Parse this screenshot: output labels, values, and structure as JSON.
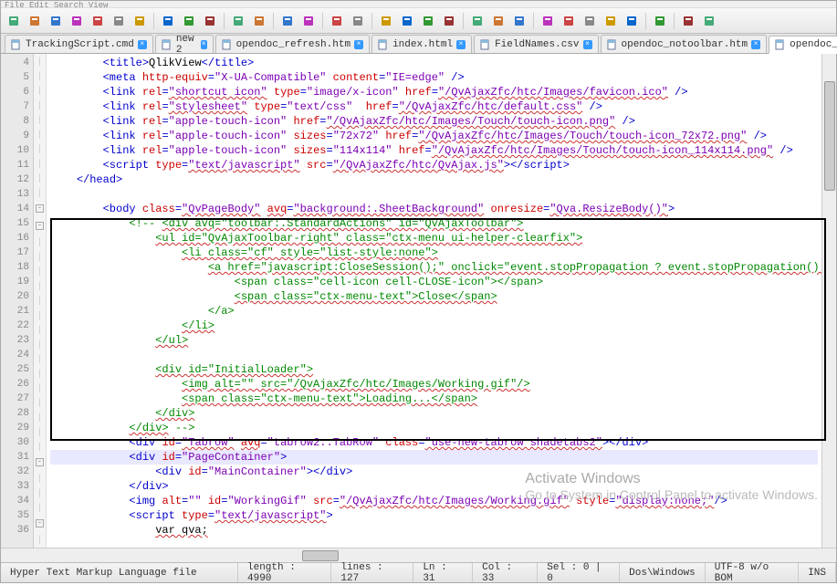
{
  "menu_hint": "File  Edit  Search  View",
  "tabs": [
    {
      "label": "TrackingScript.cmd",
      "active": false
    },
    {
      "label": "new  2",
      "active": false
    },
    {
      "label": "opendoc_refresh.htm",
      "active": false
    },
    {
      "label": "index.html",
      "active": false
    },
    {
      "label": "FieldNames.csv",
      "active": false
    },
    {
      "label": "opendoc_notoolbar.htm",
      "active": false
    },
    {
      "label": "opendoc_notoolbar.htm",
      "active": true
    }
  ],
  "line_start": 4,
  "line_end": 36,
  "cursor_line": 31,
  "code_lines": [
    {
      "n": 4,
      "indent": 2,
      "tokens": [
        [
          "t-tag",
          "<title>"
        ],
        [
          "t-txt",
          "QlikView"
        ],
        [
          "t-tag",
          "</title>"
        ]
      ]
    },
    {
      "n": 5,
      "indent": 2,
      "tokens": [
        [
          "t-tag",
          "<meta "
        ],
        [
          "t-attr",
          "http-equiv"
        ],
        [
          "t-tag",
          "="
        ],
        [
          "t-val",
          "\"X-UA-Compatible\""
        ],
        [
          "t-tag",
          " "
        ],
        [
          "t-attr",
          "content"
        ],
        [
          "t-tag",
          "="
        ],
        [
          "t-val",
          "\"IE=edge\""
        ],
        [
          "t-tag",
          " />"
        ]
      ]
    },
    {
      "n": 6,
      "indent": 2,
      "tokens": [
        [
          "t-tag",
          "<link "
        ],
        [
          "t-attr",
          "rel"
        ],
        [
          "t-tag",
          "="
        ],
        [
          "t-val t-wavy",
          "\"shortcut icon\""
        ],
        [
          "t-tag",
          " "
        ],
        [
          "t-attr",
          "type"
        ],
        [
          "t-tag",
          "="
        ],
        [
          "t-val",
          "\"image/x-icon\""
        ],
        [
          "t-tag",
          " "
        ],
        [
          "t-attr",
          "href"
        ],
        [
          "t-tag",
          "="
        ],
        [
          "t-val t-wavy",
          "\"/QvAjaxZfc/htc/Images/favicon.ico\""
        ],
        [
          "t-tag",
          " />"
        ]
      ]
    },
    {
      "n": 7,
      "indent": 2,
      "tokens": [
        [
          "t-tag",
          "<link "
        ],
        [
          "t-attr",
          "rel"
        ],
        [
          "t-tag",
          "="
        ],
        [
          "t-val t-wavy",
          "\"stylesheet\""
        ],
        [
          "t-tag",
          " "
        ],
        [
          "t-attr",
          "type"
        ],
        [
          "t-tag",
          "="
        ],
        [
          "t-val",
          "\"text/css\""
        ],
        [
          "t-tag",
          "  "
        ],
        [
          "t-attr",
          "href"
        ],
        [
          "t-tag",
          "="
        ],
        [
          "t-val t-wavy",
          "\"/QvAjaxZfc/htc/default.css\""
        ],
        [
          "t-tag",
          " />"
        ]
      ]
    },
    {
      "n": 8,
      "indent": 2,
      "tokens": [
        [
          "t-tag",
          "<link "
        ],
        [
          "t-attr",
          "rel"
        ],
        [
          "t-tag",
          "="
        ],
        [
          "t-val",
          "\"apple-touch-icon\""
        ],
        [
          "t-tag",
          " "
        ],
        [
          "t-attr",
          "href"
        ],
        [
          "t-tag",
          "="
        ],
        [
          "t-val t-wavy",
          "\"/QvAjaxZfc/htc/Images/Touch/touch-icon.png\""
        ],
        [
          "t-tag",
          " />"
        ]
      ]
    },
    {
      "n": 9,
      "indent": 2,
      "tokens": [
        [
          "t-tag",
          "<link "
        ],
        [
          "t-attr",
          "rel"
        ],
        [
          "t-tag",
          "="
        ],
        [
          "t-val",
          "\"apple-touch-icon\""
        ],
        [
          "t-tag",
          " "
        ],
        [
          "t-attr",
          "sizes"
        ],
        [
          "t-tag",
          "="
        ],
        [
          "t-val",
          "\"72x72\""
        ],
        [
          "t-tag",
          " "
        ],
        [
          "t-attr",
          "href"
        ],
        [
          "t-tag",
          "="
        ],
        [
          "t-val t-wavy",
          "\"/QvAjaxZfc/htc/Images/Touch/touch-icon_72x72.png\""
        ],
        [
          "t-tag",
          " />"
        ]
      ]
    },
    {
      "n": 10,
      "indent": 2,
      "tokens": [
        [
          "t-tag",
          "<link "
        ],
        [
          "t-attr",
          "rel"
        ],
        [
          "t-tag",
          "="
        ],
        [
          "t-val",
          "\"apple-touch-icon\""
        ],
        [
          "t-tag",
          " "
        ],
        [
          "t-attr",
          "sizes"
        ],
        [
          "t-tag",
          "="
        ],
        [
          "t-val",
          "\"114x114\""
        ],
        [
          "t-tag",
          " "
        ],
        [
          "t-attr",
          "href"
        ],
        [
          "t-tag",
          "="
        ],
        [
          "t-val t-wavy",
          "\"/QvAjaxZfc/htc/Images/Touch/touch-icon_114x114.png\""
        ],
        [
          "t-tag",
          " />"
        ]
      ]
    },
    {
      "n": 11,
      "indent": 2,
      "tokens": [
        [
          "t-tag",
          "<script "
        ],
        [
          "t-attr",
          "type"
        ],
        [
          "t-tag",
          "="
        ],
        [
          "t-val t-wavy",
          "\"text/javascript\""
        ],
        [
          "t-tag",
          " "
        ],
        [
          "t-attr",
          "src"
        ],
        [
          "t-tag",
          "="
        ],
        [
          "t-val t-wavy",
          "\"/QvAjaxZfc/htc/QvAjax.js\""
        ],
        [
          "t-tag",
          "></script>"
        ]
      ]
    },
    {
      "n": 12,
      "indent": 1,
      "tokens": [
        [
          "t-tag",
          "</head>"
        ]
      ]
    },
    {
      "n": 13,
      "indent": 0,
      "tokens": [
        [
          "t-txt",
          ""
        ]
      ]
    },
    {
      "n": 14,
      "indent": 2,
      "tokens": [
        [
          "t-tag",
          "<body "
        ],
        [
          "t-attr",
          "class"
        ],
        [
          "t-tag",
          "="
        ],
        [
          "t-val t-wavy",
          "\"QvPageBody\""
        ],
        [
          "t-tag",
          " "
        ],
        [
          "t-attr t-wavy",
          "avq"
        ],
        [
          "t-tag",
          "="
        ],
        [
          "t-val t-wavy",
          "\"background:.SheetBackground\""
        ],
        [
          "t-tag",
          " "
        ],
        [
          "t-attr",
          "onresize"
        ],
        [
          "t-tag",
          "="
        ],
        [
          "t-val t-wavy",
          "\"Qva.ResizeBody()\""
        ],
        [
          "t-tag",
          ">"
        ]
      ]
    },
    {
      "n": 15,
      "indent": 3,
      "tokens": [
        [
          "t-com",
          "<!-- "
        ],
        [
          "t-com t-wavy",
          "<div avq=\"toolbar:.StandardActions\" id=\"QvAjaxToolbar\">"
        ]
      ]
    },
    {
      "n": 16,
      "indent": 4,
      "tokens": [
        [
          "t-com t-wavy",
          "<ul id=\"QvAjaxToolbar-right\" class=\"ctx-menu ui-helper-clearfix\">"
        ]
      ]
    },
    {
      "n": 17,
      "indent": 5,
      "tokens": [
        [
          "t-com t-wavy",
          "<li class=\"cf\" style=\"list-style:none\">"
        ]
      ]
    },
    {
      "n": 18,
      "indent": 6,
      "tokens": [
        [
          "t-com t-wavy",
          "<a href=\"javascript:CloseSession();\" onclick=\"event.stopPropagation ? event.stopPropagation() :"
        ]
      ]
    },
    {
      "n": 19,
      "indent": 7,
      "tokens": [
        [
          "t-com",
          "<span class=\"cell-icon cell-CLOSE-icon\"></span>"
        ]
      ]
    },
    {
      "n": 20,
      "indent": 7,
      "tokens": [
        [
          "t-com t-wavy",
          "<span class=\"ctx-menu-text\">Close</span>"
        ]
      ]
    },
    {
      "n": 21,
      "indent": 6,
      "tokens": [
        [
          "t-com",
          "</a>"
        ]
      ]
    },
    {
      "n": 22,
      "indent": 5,
      "tokens": [
        [
          "t-com t-wavy",
          "</li>"
        ]
      ]
    },
    {
      "n": 23,
      "indent": 4,
      "tokens": [
        [
          "t-com t-wavy",
          "</ul>"
        ]
      ]
    },
    {
      "n": 24,
      "indent": 0,
      "tokens": [
        [
          "t-txt",
          ""
        ]
      ]
    },
    {
      "n": 25,
      "indent": 4,
      "tokens": [
        [
          "t-com t-wavy",
          "<div id=\"InitialLoader\">"
        ]
      ]
    },
    {
      "n": 26,
      "indent": 5,
      "tokens": [
        [
          "t-com t-wavy",
          "<img alt=\"\" src=\"/QvAjaxZfc/htc/Images/Working.gif\"/>"
        ]
      ]
    },
    {
      "n": 27,
      "indent": 5,
      "tokens": [
        [
          "t-com t-wavy",
          "<span class=\"ctx-menu-text\">Loading...</span>"
        ]
      ]
    },
    {
      "n": 28,
      "indent": 4,
      "tokens": [
        [
          "t-com t-wavy",
          "</div>"
        ]
      ]
    },
    {
      "n": 29,
      "indent": 3,
      "tokens": [
        [
          "t-com t-wavy",
          "</div>"
        ],
        [
          "t-com",
          " -->"
        ]
      ]
    },
    {
      "n": 30,
      "indent": 3,
      "tokens": [
        [
          "t-tag",
          "<div "
        ],
        [
          "t-attr",
          "id"
        ],
        [
          "t-tag",
          "="
        ],
        [
          "t-val t-wavy",
          "\"Tabrow\""
        ],
        [
          "t-tag",
          " "
        ],
        [
          "t-attr t-wavy",
          "avq"
        ],
        [
          "t-tag",
          "="
        ],
        [
          "t-val",
          "\"tabrow2:.TabRow\""
        ],
        [
          "t-tag",
          " "
        ],
        [
          "t-attr",
          "class"
        ],
        [
          "t-tag",
          "="
        ],
        [
          "t-val t-wavy",
          "\"use-new-tabrow shadetabs2\""
        ],
        [
          "t-tag",
          "></div>"
        ]
      ]
    },
    {
      "n": 31,
      "indent": 3,
      "tokens": [
        [
          "t-tag",
          "<div "
        ],
        [
          "t-attr",
          "id"
        ],
        [
          "t-tag",
          "="
        ],
        [
          "t-val",
          "\"PageContainer\""
        ],
        [
          "t-tag",
          ">"
        ]
      ],
      "cursor": true
    },
    {
      "n": 32,
      "indent": 4,
      "tokens": [
        [
          "t-tag",
          "<div "
        ],
        [
          "t-attr",
          "id"
        ],
        [
          "t-tag",
          "="
        ],
        [
          "t-val",
          "\"MainContainer\""
        ],
        [
          "t-tag",
          "></div>"
        ]
      ]
    },
    {
      "n": 33,
      "indent": 3,
      "tokens": [
        [
          "t-tag",
          "</div>"
        ]
      ]
    },
    {
      "n": 34,
      "indent": 3,
      "tokens": [
        [
          "t-tag",
          "<img "
        ],
        [
          "t-attr",
          "alt"
        ],
        [
          "t-tag",
          "="
        ],
        [
          "t-val",
          "\"\""
        ],
        [
          "t-tag",
          " "
        ],
        [
          "t-attr",
          "id"
        ],
        [
          "t-tag",
          "="
        ],
        [
          "t-val",
          "\"WorkingGif\""
        ],
        [
          "t-tag",
          " "
        ],
        [
          "t-attr",
          "src"
        ],
        [
          "t-tag",
          "="
        ],
        [
          "t-val t-wavy",
          "\"/QvAjaxZfc/htc/Images/Working.gif\""
        ],
        [
          "t-tag",
          " "
        ],
        [
          "t-attr",
          "style"
        ],
        [
          "t-tag",
          "="
        ],
        [
          "t-val t-wavy",
          "\"display:none;\""
        ],
        [
          "t-tag",
          "/>"
        ]
      ]
    },
    {
      "n": 35,
      "indent": 3,
      "tokens": [
        [
          "t-tag",
          "<script "
        ],
        [
          "t-attr",
          "type"
        ],
        [
          "t-tag",
          "="
        ],
        [
          "t-val t-wavy",
          "\"text/javascript\""
        ],
        [
          "t-tag",
          ">"
        ]
      ]
    },
    {
      "n": 36,
      "indent": 4,
      "tokens": [
        [
          "t-txt t-wavy",
          "var qva;"
        ]
      ]
    }
  ],
  "fold_markers": {
    "14": "-",
    "15": "-",
    "31": "-",
    "35": "-"
  },
  "status": {
    "filetype": "Hyper Text Markup Language file",
    "length": "length : 4990",
    "lines": "lines : 127",
    "ln": "Ln : 31",
    "col": "Col : 33",
    "sel": "Sel : 0 | 0",
    "eol": "Dos\\Windows",
    "enc": "UTF-8 w/o BOM",
    "ovr": "INS"
  },
  "watermark": {
    "title": "Activate Windows",
    "sub": "Go to System in Control Panel to activate Windows."
  },
  "toolbar_icons": [
    "new-file-icon",
    "open-icon",
    "save-icon",
    "save-all-icon",
    "close-icon",
    "close-all-icon",
    "print-icon",
    "sep",
    "cut-icon",
    "copy-icon",
    "paste-icon",
    "sep",
    "undo-icon",
    "redo-icon",
    "sep",
    "find-icon",
    "replace-icon",
    "sep",
    "zoom-in-icon",
    "zoom-out-icon",
    "sep",
    "sync-icon",
    "wrap-icon",
    "whitespace-icon",
    "indent-guide-icon",
    "sep",
    "fold-icon",
    "unfold-icon",
    "hide-lines-icon",
    "sep",
    "record-icon",
    "play-icon",
    "stop-icon",
    "repeat-icon",
    "save-macro-icon",
    "sep",
    "spellcheck-icon",
    "sep",
    "doc-map-icon",
    "function-list-icon"
  ]
}
